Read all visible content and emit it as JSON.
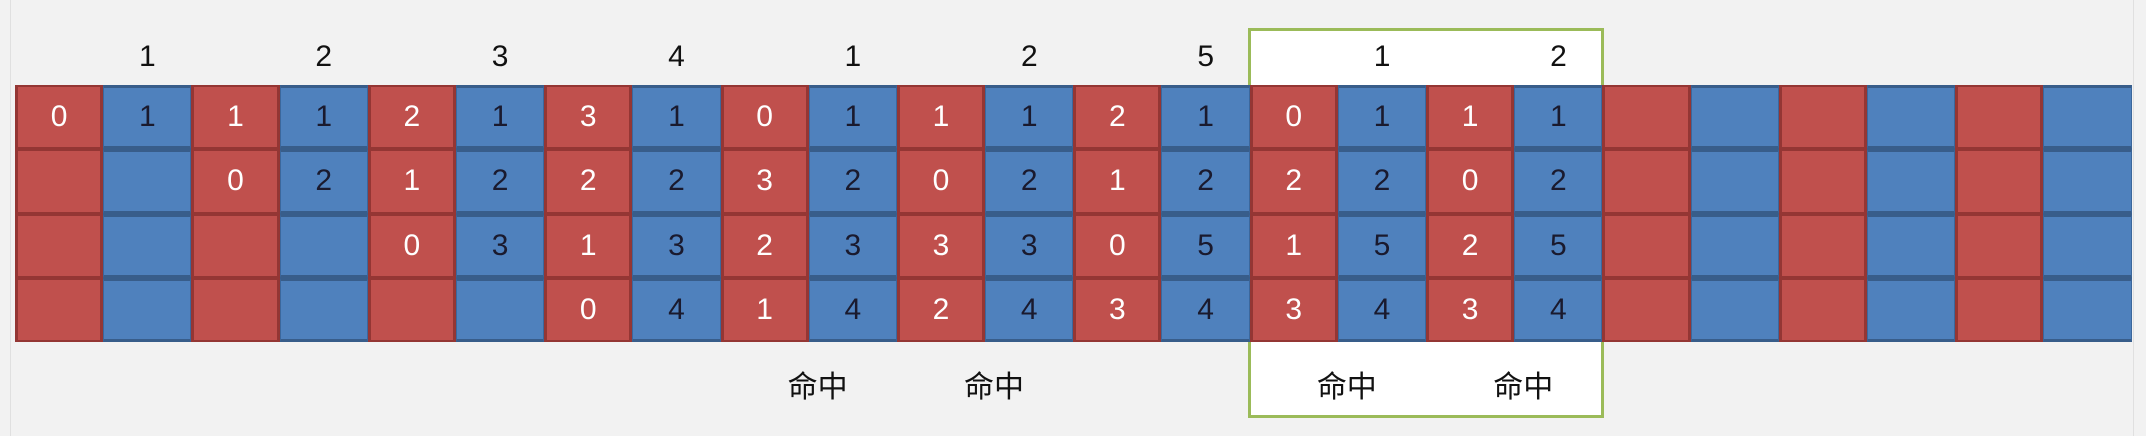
{
  "colors": {
    "red": "#c0504d",
    "blue": "#4f81bd",
    "highlight_border": "#9bbb59"
  },
  "pairs": [
    {
      "label": "1",
      "red": [
        "0",
        "",
        "",
        ""
      ],
      "blue": [
        "1",
        "",
        "",
        ""
      ],
      "hit": ""
    },
    {
      "label": "2",
      "red": [
        "1",
        "0",
        "",
        ""
      ],
      "blue": [
        "1",
        "2",
        "",
        ""
      ],
      "hit": ""
    },
    {
      "label": "3",
      "red": [
        "2",
        "1",
        "0",
        ""
      ],
      "blue": [
        "1",
        "2",
        "3",
        ""
      ],
      "hit": ""
    },
    {
      "label": "4",
      "red": [
        "3",
        "2",
        "1",
        "0"
      ],
      "blue": [
        "1",
        "2",
        "3",
        "4"
      ],
      "hit": ""
    },
    {
      "label": "1",
      "red": [
        "0",
        "3",
        "2",
        "1"
      ],
      "blue": [
        "1",
        "2",
        "3",
        "4"
      ],
      "hit": "命中"
    },
    {
      "label": "2",
      "red": [
        "1",
        "0",
        "3",
        "2"
      ],
      "blue": [
        "1",
        "2",
        "3",
        "4"
      ],
      "hit": "命中"
    },
    {
      "label": "5",
      "red": [
        "2",
        "1",
        "0",
        "3"
      ],
      "blue": [
        "1",
        "2",
        "5",
        "4"
      ],
      "hit": ""
    },
    {
      "label": "1",
      "red": [
        "0",
        "2",
        "1",
        "3"
      ],
      "blue": [
        "1",
        "2",
        "5",
        "4"
      ],
      "hit": "命中"
    },
    {
      "label": "2",
      "red": [
        "1",
        "0",
        "2",
        "3"
      ],
      "blue": [
        "1",
        "2",
        "5",
        "4"
      ],
      "hit": "命中"
    },
    {
      "label": "",
      "red": [
        "",
        "",
        "",
        ""
      ],
      "blue": [
        "",
        "",
        "",
        ""
      ],
      "hit": ""
    },
    {
      "label": "",
      "red": [
        "",
        "",
        "",
        ""
      ],
      "blue": [
        "",
        "",
        "",
        ""
      ],
      "hit": ""
    },
    {
      "label": "",
      "red": [
        "",
        "",
        "",
        ""
      ],
      "blue": [
        "",
        "",
        "",
        ""
      ],
      "hit": ""
    }
  ]
}
